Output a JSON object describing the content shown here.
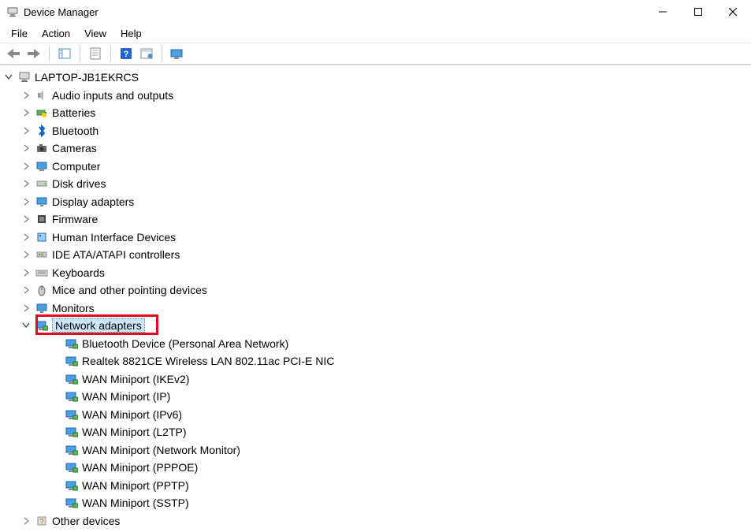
{
  "window": {
    "title": "Device Manager"
  },
  "menu": {
    "file": "File",
    "action": "Action",
    "view": "View",
    "help": "Help"
  },
  "tree": {
    "root": "LAPTOP-JB1EKRCS",
    "categories": [
      {
        "label": "Audio inputs and outputs",
        "expanded": false,
        "icon": "speaker"
      },
      {
        "label": "Batteries",
        "expanded": false,
        "icon": "battery"
      },
      {
        "label": "Bluetooth",
        "expanded": false,
        "icon": "bluetooth"
      },
      {
        "label": "Cameras",
        "expanded": false,
        "icon": "camera"
      },
      {
        "label": "Computer",
        "expanded": false,
        "icon": "computer"
      },
      {
        "label": "Disk drives",
        "expanded": false,
        "icon": "disk"
      },
      {
        "label": "Display adapters",
        "expanded": false,
        "icon": "display"
      },
      {
        "label": "Firmware",
        "expanded": false,
        "icon": "firmware"
      },
      {
        "label": "Human Interface Devices",
        "expanded": false,
        "icon": "hid"
      },
      {
        "label": "IDE ATA/ATAPI controllers",
        "expanded": false,
        "icon": "ide"
      },
      {
        "label": "Keyboards",
        "expanded": false,
        "icon": "keyboard"
      },
      {
        "label": "Mice and other pointing devices",
        "expanded": false,
        "icon": "mouse"
      },
      {
        "label": "Monitors",
        "expanded": false,
        "icon": "monitor"
      },
      {
        "label": "Network adapters",
        "expanded": true,
        "icon": "network",
        "selected": true,
        "children": [
          "Bluetooth Device (Personal Area Network)",
          "Realtek 8821CE Wireless LAN 802.11ac PCI-E NIC",
          "WAN Miniport (IKEv2)",
          "WAN Miniport (IP)",
          "WAN Miniport (IPv6)",
          "WAN Miniport (L2TP)",
          "WAN Miniport (Network Monitor)",
          "WAN Miniport (PPPOE)",
          "WAN Miniport (PPTP)",
          "WAN Miniport (SSTP)"
        ]
      },
      {
        "label": "Other devices",
        "expanded": false,
        "icon": "other"
      }
    ]
  }
}
